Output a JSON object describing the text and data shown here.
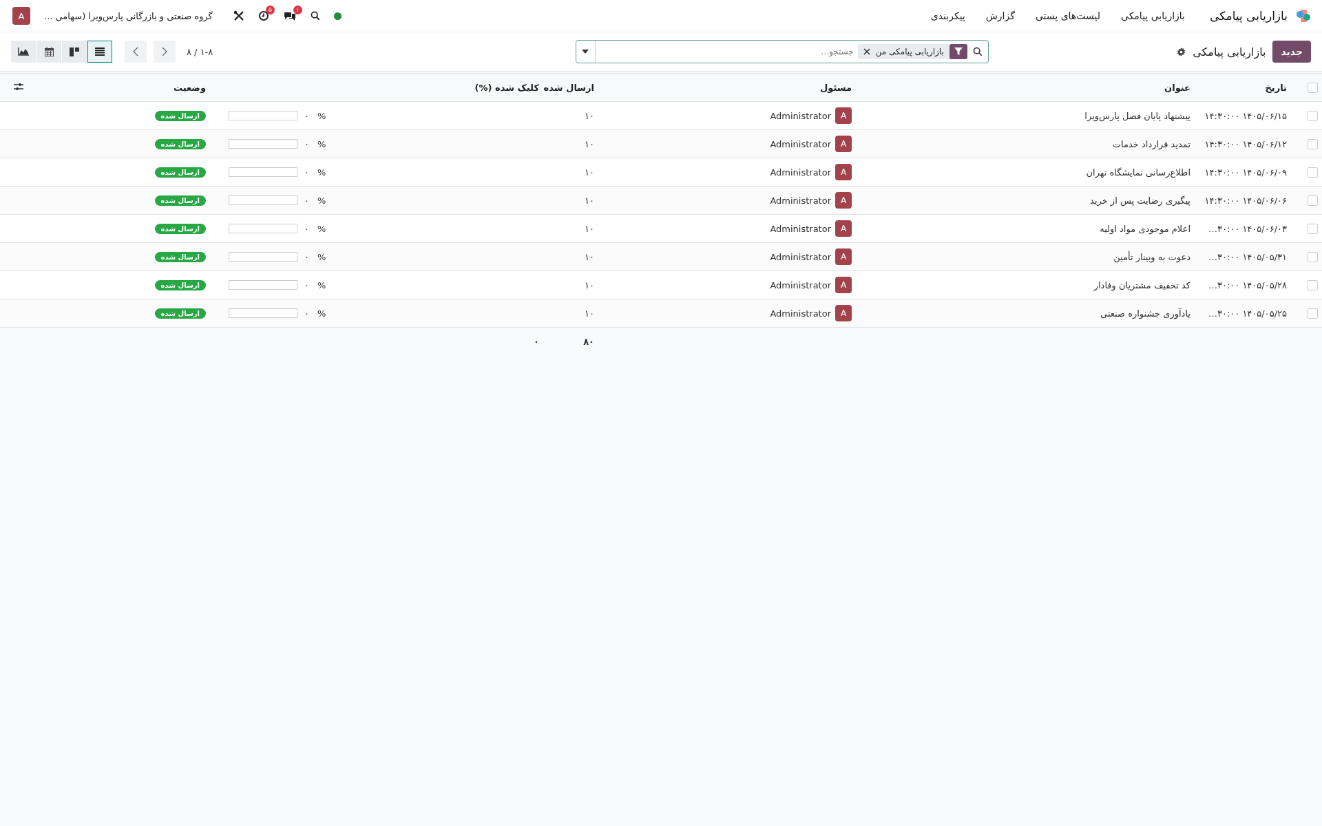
{
  "navbar": {
    "app_name": "بازاریابی پیامکی",
    "menus": [
      "بازاریابی پیامکی",
      "لیست‌های پستی",
      "گزارش",
      "پیکربندی"
    ],
    "status": {
      "online": true
    },
    "systray": [
      {
        "kind": "search"
      },
      {
        "kind": "chat",
        "badge": "۱"
      },
      {
        "kind": "activity",
        "badge": "۵"
      },
      {
        "kind": "tools"
      }
    ],
    "company": "گروه صنعتی و بازرگانی پارس‌ویرا (سهامی ...",
    "user_initial": "A"
  },
  "control_panel": {
    "new_button": "جدید",
    "breadcrumb": "بازاریابی پیامکی",
    "search": {
      "facet": "بازاریابی پیامکی من",
      "placeholder": "جستجو..."
    },
    "pager": "۱-۸ / ۸",
    "views": [
      {
        "kind": "list",
        "selected": true
      },
      {
        "kind": "kanban",
        "selected": false
      },
      {
        "kind": "calendar",
        "selected": false
      },
      {
        "kind": "graph",
        "selected": false
      }
    ]
  },
  "table": {
    "select_all_checked": false,
    "columns": [
      "تاریخ",
      "عنوان",
      "مسئول",
      "ارسال شده",
      "کلیک شده (%)",
      "وضعیت"
    ],
    "rows": [
      {
        "selected": false,
        "date": "۱۴۰۵/۰۶/۱۵ ۱۴:۳۰:۰۰",
        "title": "پیشنهاد پایان فصل پارس‌ویرا",
        "responsible": "Administrator",
        "initial": "A",
        "sent": "۱۰",
        "clicked": "%",
        "progress_value": "۰",
        "level": 0,
        "status": "ارسال شده"
      },
      {
        "selected": false,
        "date": "۱۴۰۵/۰۶/۱۲ ۱۴:۳۰:۰۰",
        "title": "تمدید قرارداد خدمات",
        "responsible": "Administrator",
        "initial": "A",
        "sent": "۱۰",
        "clicked": "%",
        "progress_value": "۰",
        "level": 0,
        "status": "ارسال شده"
      },
      {
        "selected": false,
        "date": "۱۴۰۵/۰۶/۰۹ ۱۴:۳۰:۰۰",
        "title": "اطلاع‌رسانی نمایشگاه تهران",
        "responsible": "Administrator",
        "initial": "A",
        "sent": "۱۰",
        "clicked": "%",
        "progress_value": "۰",
        "level": 0,
        "status": "ارسال شده"
      },
      {
        "selected": false,
        "date": "۱۴۰۵/۰۶/۰۶ ۱۴:۳۰:۰۰",
        "title": "پیگیری رضایت پس از خرید",
        "responsible": "Administrator",
        "initial": "A",
        "sent": "۱۰",
        "clicked": "%",
        "progress_value": "۰",
        "level": 0,
        "status": "ارسال شده"
      },
      {
        "selected": false,
        "date": "۱۴۰۵/۰۶/۰۳ ۳۰:۰۰…",
        "title": "اعلام موجودی مواد اولیه",
        "responsible": "Administrator",
        "initial": "A",
        "sent": "۱۰",
        "clicked": "%",
        "progress_value": "۰",
        "level": 0,
        "status": "ارسال شده"
      },
      {
        "selected": false,
        "date": "۱۴۰۵/۰۵/۳۱ ۳۰:۰۰…",
        "title": "دعوت به وبینار تأمین",
        "responsible": "Administrator",
        "initial": "A",
        "sent": "۱۰",
        "clicked": "%",
        "progress_value": "۰",
        "level": 0,
        "status": "ارسال شده"
      },
      {
        "selected": false,
        "date": "۱۴۰۵/۰۵/۲۸ ۳۰:۰۰…",
        "title": "کد تخفیف مشتریان وفادار",
        "responsible": "Administrator",
        "initial": "A",
        "sent": "۱۰",
        "clicked": "%",
        "progress_value": "۰",
        "level": 0,
        "status": "ارسال شده"
      },
      {
        "selected": false,
        "date": "۱۴۰۵/۰۵/۲۵ ۳۰:۰۰…",
        "title": "یادآوری جشنواره صنعتی",
        "responsible": "Administrator",
        "initial": "A",
        "sent": "۱۰",
        "clicked": "%",
        "progress_value": "۰",
        "level": 0,
        "status": "ارسال شده"
      }
    ],
    "totals": {
      "sent": "۸۰",
      "clicked": "۰"
    }
  }
}
